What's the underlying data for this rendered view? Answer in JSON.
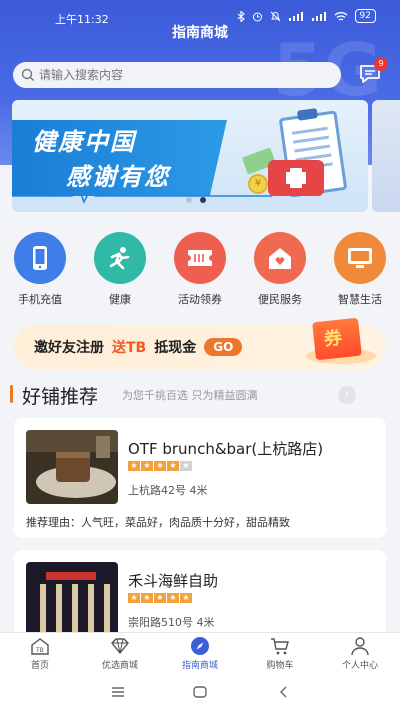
{
  "status": {
    "time": "上午11:32",
    "battery": "92"
  },
  "header": {
    "title": "指南商城",
    "search_placeholder": "请输入搜索内容",
    "message_badge": "9"
  },
  "banner": {
    "line1": "健康中国",
    "line2": "感谢有您",
    "coin_symbol": "¥",
    "slides": 2,
    "active_slide": 2
  },
  "categories": [
    {
      "label": "手机充值",
      "icon": "phone-icon",
      "color": "#3f7ee8"
    },
    {
      "label": "健康",
      "icon": "health-icon",
      "color": "#2fb9a6"
    },
    {
      "label": "活动领券",
      "icon": "ticket-icon",
      "color": "#ef5f4f"
    },
    {
      "label": "便民服务",
      "icon": "home-heart-icon",
      "color": "#f06a52"
    },
    {
      "label": "智慧生活",
      "icon": "monitor-icon",
      "color": "#f08a3a"
    }
  ],
  "invite": {
    "text": "邀好友注册",
    "highlight": "送TB",
    "reward": "抵现金",
    "button": "GO",
    "coupon": "券"
  },
  "section": {
    "title": "好铺推荐",
    "subtitle": "为您千挑百选 只为精益圆满",
    "more": "›"
  },
  "shops": [
    {
      "name": "OTF brunch&bar(上杭路店)",
      "rating": 4,
      "address": "上杭路42号 4米",
      "reason": "推荐理由：人气旺，菜品好，肉品质十分好，甜品精致"
    },
    {
      "name": "禾斗海鲜自助",
      "rating": 5,
      "address": "崇阳路510号 4米"
    }
  ],
  "tabs": [
    {
      "label": "首页",
      "icon": "home-icon"
    },
    {
      "label": "优选商城",
      "icon": "diamond-icon"
    },
    {
      "label": "指南商城",
      "icon": "compass-icon",
      "active": true
    },
    {
      "label": "购物车",
      "icon": "cart-icon"
    },
    {
      "label": "个人中心",
      "icon": "person-icon"
    }
  ],
  "colors": {
    "brand": "#3b5bd9",
    "accent": "#f0762b",
    "star": "#f3a13a"
  }
}
